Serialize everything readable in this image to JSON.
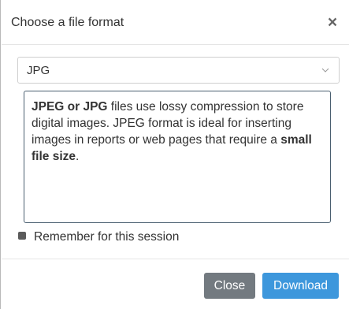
{
  "dialog": {
    "title": "Choose a file format",
    "close_icon": "close-x-icon"
  },
  "format_select": {
    "selected": "JPG",
    "chevron_icon": "chevron-down-icon"
  },
  "description": {
    "part1_bold": "JPEG or JPG",
    "part2": " files use lossy compression to store digital images. JPEG format is ideal for inserting images in reports or web pages that require a ",
    "part3_bold": "small file size",
    "part4": "."
  },
  "remember": {
    "label": "Remember for this session",
    "checked": true
  },
  "footer": {
    "close_label": "Close",
    "download_label": "Download"
  },
  "colors": {
    "close_button": "#737a80",
    "download_button": "#3d97dc",
    "description_border": "#4a5f70"
  }
}
